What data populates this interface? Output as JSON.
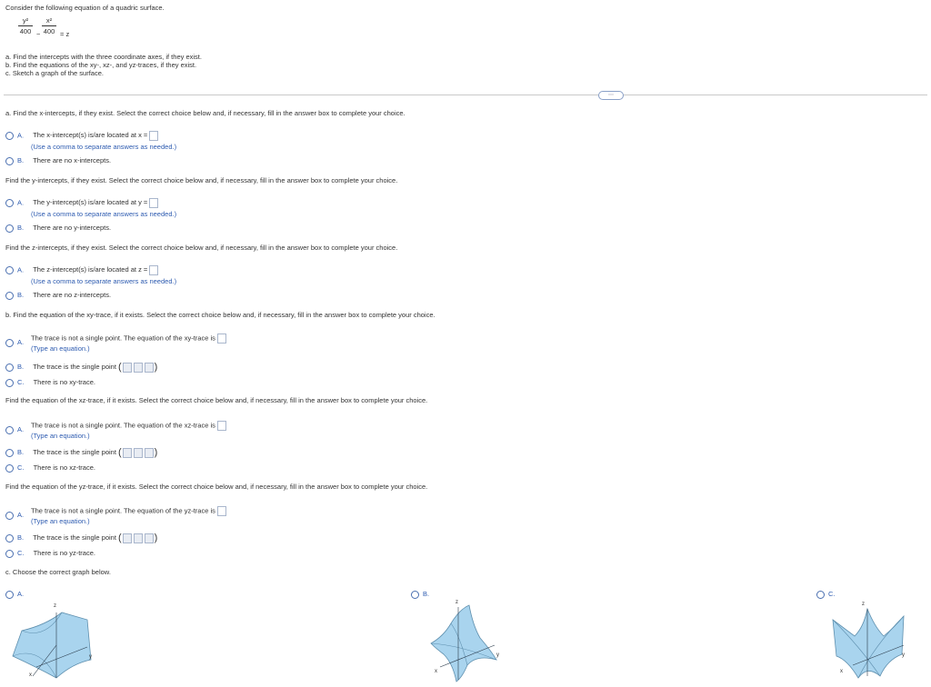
{
  "problem": {
    "intro": "Consider the following equation of a quadric surface.",
    "eq": {
      "t1_num": "y²",
      "t1_den": "400",
      "minus": "−",
      "t2_num": "x²",
      "t2_den": "400",
      "rhs": "= z"
    },
    "tasks": [
      "a. Find the intercepts with the three coordinate axes, if they exist.",
      "b. Find the equations of the xy-, xz-, and yz-traces, if they exist.",
      "c. Sketch a graph of the surface."
    ]
  },
  "more_label": "⋯",
  "a": {
    "prompt_x": "a. Find the x-intercepts, if they exist. Select the correct choice below and, if necessary, fill in the answer box to complete your choice.",
    "x_A_letter": "A.",
    "x_A_text": "The x-intercept(s) is/are located at x =",
    "x_A_hint": "(Use a comma to separate answers as needed.)",
    "x_B_letter": "B.",
    "x_B_text": "There are no x-intercepts.",
    "prompt_y": "Find the y-intercepts, if they exist. Select the correct choice below and, if necessary, fill in the answer box to complete your choice.",
    "y_A_letter": "A.",
    "y_A_text": "The y-intercept(s) is/are located at y =",
    "y_A_hint": "(Use a comma to separate answers as needed.)",
    "y_B_letter": "B.",
    "y_B_text": "There are no y-intercepts.",
    "prompt_z": "Find the z-intercepts, if they exist. Select the correct choice below and, if necessary, fill in the answer box to complete your choice.",
    "z_A_letter": "A.",
    "z_A_text": "The z-intercept(s) is/are located at z =",
    "z_A_hint": "(Use a comma to separate answers as needed.)",
    "z_B_letter": "B.",
    "z_B_text": "There are no z-intercepts."
  },
  "b": {
    "prompt_xy": "b. Find the equation of the xy-trace, if it exists. Select the correct choice below and, if necessary, fill in the answer box to complete your choice.",
    "xy_A_letter": "A.",
    "xy_A_text": "The trace is not a single point. The equation of the xy-trace is",
    "xy_A_hint": "(Type an equation.)",
    "xy_B_letter": "B.",
    "xy_B_text": "The trace is the single point",
    "xy_C_letter": "C.",
    "xy_C_text": "There is no xy-trace.",
    "prompt_xz": "Find the equation of the xz-trace, if it exists. Select the correct choice below and, if necessary, fill in the answer box to complete your choice.",
    "xz_A_letter": "A.",
    "xz_A_text": "The trace is not a single point. The equation of the xz-trace is",
    "xz_A_hint": "(Type an equation.)",
    "xz_B_letter": "B.",
    "xz_B_text": "The trace is the single point",
    "xz_C_letter": "C.",
    "xz_C_text": "There is no xz-trace.",
    "prompt_yz": "Find the equation of the yz-trace, if it exists. Select the correct choice below and, if necessary, fill in the answer box to complete your choice.",
    "yz_A_letter": "A.",
    "yz_A_text": "The trace is not a single point. The equation of the yz-trace is",
    "yz_A_hint": "(Type an equation.)",
    "yz_B_letter": "B.",
    "yz_B_text": "The trace is the single point",
    "yz_C_letter": "C.",
    "yz_C_text": "There is no yz-trace."
  },
  "c": {
    "prompt": "c. Choose the correct graph below.",
    "A_letter": "A.",
    "B_letter": "B.",
    "C_letter": "C.",
    "axis_x": "x",
    "axis_y": "y",
    "axis_z": "z"
  },
  "colors": {
    "accent": "#2d5bb0",
    "surface": "#a9d4ee",
    "surface_edge": "#5e8fae"
  }
}
